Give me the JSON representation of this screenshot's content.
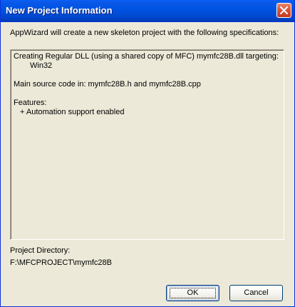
{
  "window": {
    "title": "New Project Information",
    "close_icon": "close-x-icon"
  },
  "intro_text": "AppWizard will create a new skeleton project with the following specifications:",
  "specifications": {
    "line1": "Creating Regular DLL (using a shared copy of MFC) mymfc28B.dll targeting:",
    "line2": "Win32",
    "line3": "Main source code in: mymfc28B.h and mymfc28B.cpp",
    "line4": "Features:",
    "line5": "+ Automation support enabled"
  },
  "project_directory": {
    "label": "Project Directory:",
    "value": "F:\\MFCPROJECT\\mymfc28B"
  },
  "buttons": {
    "ok_label": "OK",
    "cancel_label": "Cancel"
  },
  "colors": {
    "title_bar": "#0054E3",
    "close_button": "#D9553A",
    "dialog_face": "#ECE9D8"
  }
}
